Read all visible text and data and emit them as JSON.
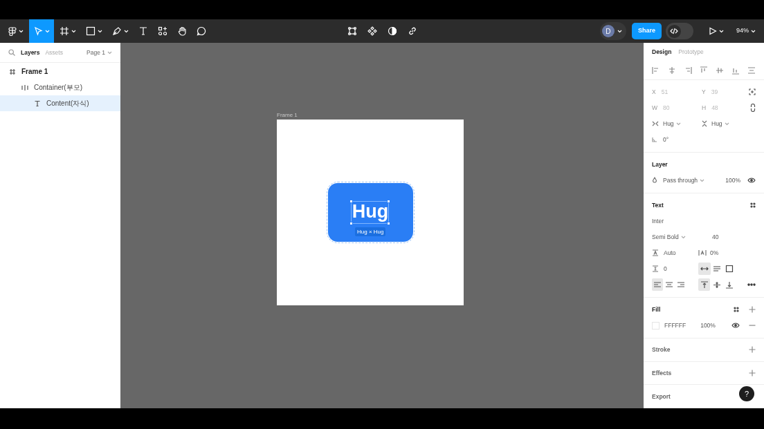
{
  "toolbar": {
    "tools": [
      {
        "kind": "main-menu",
        "selected": false
      },
      {
        "kind": "move",
        "selected": true
      },
      {
        "kind": "frame",
        "selected": false
      },
      {
        "kind": "shape",
        "selected": false
      },
      {
        "kind": "pen",
        "selected": false
      },
      {
        "kind": "text",
        "selected": false
      },
      {
        "kind": "actions",
        "selected": false
      },
      {
        "kind": "hand",
        "selected": false
      },
      {
        "kind": "comment",
        "selected": false
      }
    ],
    "avatar": "D",
    "share": "Share",
    "dev_mode": {
      "on": false
    },
    "zoom": "94%"
  },
  "layers_panel": {
    "tabs": [
      {
        "label": "Layers",
        "selected": true
      },
      {
        "label": "Assets",
        "selected": false
      }
    ],
    "page": "Page 1",
    "layers": [
      {
        "name": "Frame 1",
        "kind": "frame",
        "selected": false,
        "children": [
          {
            "name": "Container(부모)",
            "kind": "autolayout",
            "selected": false,
            "children": [
              {
                "name": "Content(자식)",
                "kind": "text",
                "selected": true
              }
            ]
          }
        ]
      }
    ]
  },
  "canvas": {
    "frame_label": "Frame 1",
    "button_text": "Hug",
    "size_badge": "Hug × Hug"
  },
  "design_panel": {
    "tabs": [
      {
        "label": "Design",
        "selected": true
      },
      {
        "label": "Prototype",
        "selected": false
      }
    ],
    "position": [
      {
        "label": "X",
        "value": "51"
      },
      {
        "label": "Y",
        "value": "39"
      },
      {
        "label": "W",
        "value": "80"
      },
      {
        "label": "H",
        "value": "48"
      }
    ],
    "sizing": [
      "Hug",
      "Hug"
    ],
    "rotation": "0°",
    "layer": {
      "title": "Layer",
      "blend": "Pass through",
      "opacity": "100%"
    },
    "text": {
      "title": "Text",
      "font": "Inter",
      "weight": "Semi Bold",
      "size": "40",
      "line_height": "Auto",
      "letter_spacing": "0%",
      "paragraph_spacing": "0",
      "resizing": [
        {
          "kind": "auto-width",
          "selected": true
        },
        {
          "kind": "auto-height",
          "selected": false
        },
        {
          "kind": "fixed",
          "selected": false
        }
      ],
      "align_horizontal": [
        {
          "kind": "left",
          "selected": true
        },
        {
          "kind": "center",
          "selected": false
        },
        {
          "kind": "right",
          "selected": false
        }
      ],
      "align_vertical": [
        {
          "kind": "top",
          "selected": true
        },
        {
          "kind": "middle",
          "selected": false
        },
        {
          "kind": "bottom",
          "selected": false
        }
      ]
    },
    "fill": {
      "title": "Fill",
      "hex": "FFFFFF",
      "opacity": "100%"
    },
    "sections": [
      "Stroke",
      "Effects",
      "Export"
    ]
  },
  "help": "?"
}
